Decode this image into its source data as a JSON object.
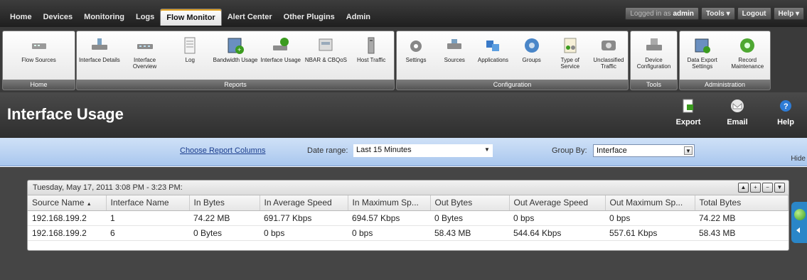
{
  "nav": {
    "tabs": [
      {
        "label": "Home",
        "active": false
      },
      {
        "label": "Devices",
        "active": false
      },
      {
        "label": "Monitoring",
        "active": false
      },
      {
        "label": "Logs",
        "active": false
      },
      {
        "label": "Flow Monitor",
        "active": true
      },
      {
        "label": "Alert Center",
        "active": false
      },
      {
        "label": "Other Plugins",
        "active": false
      },
      {
        "label": "Admin",
        "active": false
      }
    ],
    "logged_in_prefix": "Logged in as",
    "logged_in_user": "admin",
    "tools_label": "Tools",
    "logout_label": "Logout",
    "help_label": "Help"
  },
  "ribbon": {
    "groups": [
      {
        "label": "Home",
        "items": [
          {
            "label": "Flow Sources",
            "icon": "flow-sources-icon"
          }
        ]
      },
      {
        "label": "Reports",
        "items": [
          {
            "label": "Interface Details",
            "icon": "interface-details-icon"
          },
          {
            "label": "Interface Overview",
            "icon": "interface-overview-icon"
          },
          {
            "label": "Log",
            "icon": "log-icon"
          },
          {
            "label": "Bandwidth Usage",
            "icon": "bandwidth-usage-icon"
          },
          {
            "label": "Interface Usage",
            "icon": "interface-usage-icon"
          },
          {
            "label": "NBAR & CBQoS",
            "icon": "nbar-cbqos-icon"
          },
          {
            "label": "Host Traffic",
            "icon": "host-traffic-icon"
          }
        ]
      },
      {
        "label": "Configuration",
        "items": [
          {
            "label": "Settings",
            "icon": "settings-icon"
          },
          {
            "label": "Sources",
            "icon": "sources-icon"
          },
          {
            "label": "Applications",
            "icon": "applications-icon"
          },
          {
            "label": "Groups",
            "icon": "groups-icon"
          },
          {
            "label": "Type of Service",
            "icon": "type-of-service-icon"
          },
          {
            "label": "Unclassified Traffic",
            "icon": "unclassified-traffic-icon"
          }
        ]
      },
      {
        "label": "Tools",
        "items": [
          {
            "label": "Device Configuration",
            "icon": "device-configuration-icon"
          }
        ]
      },
      {
        "label": "Administration",
        "items": [
          {
            "label": "Data Export Settings",
            "icon": "data-export-settings-icon"
          },
          {
            "label": "Record Maintenance",
            "icon": "record-maintenance-icon"
          }
        ]
      }
    ]
  },
  "page": {
    "title": "Interface Usage",
    "export_label": "Export",
    "email_label": "Email",
    "help_label": "Help"
  },
  "filters": {
    "choose_columns": "Choose Report Columns",
    "date_range_label": "Date range:",
    "date_range_value": "Last 15 Minutes",
    "group_by_label": "Group By:",
    "group_by_value": "Interface",
    "hide_label": "Hide"
  },
  "report": {
    "header": "Tuesday, May 17, 2011 3:08 PM - 3:23 PM:",
    "columns": [
      "Source Name",
      "Interface Name",
      "In Bytes",
      "In Average Speed",
      "In Maximum Sp...",
      "Out Bytes",
      "Out Average Speed",
      "Out Maximum Sp...",
      "Total Bytes"
    ],
    "sort_indicator": "▲",
    "rows": [
      [
        "192.168.199.2",
        "1",
        "74.22 MB",
        "691.77 Kbps",
        "694.57 Kbps",
        "0 Bytes",
        "0 bps",
        "0 bps",
        "74.22 MB"
      ],
      [
        "192.168.199.2",
        "6",
        "0 Bytes",
        "0 bps",
        "0 bps",
        "58.43 MB",
        "544.64 Kbps",
        "557.61 Kbps",
        "58.43 MB"
      ]
    ]
  },
  "colors": {
    "accent": "#e0a020",
    "filter_bar": "#b9d2f2",
    "link": "#1a3c8c"
  }
}
